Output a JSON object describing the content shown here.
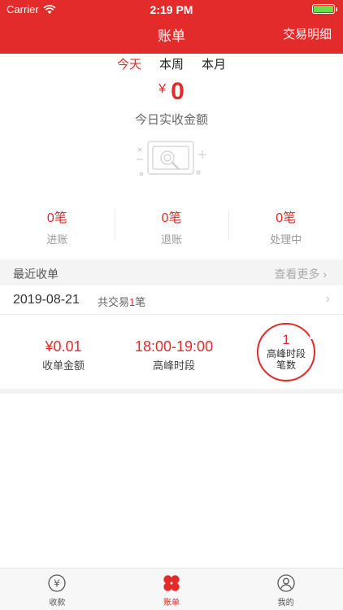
{
  "status_bar": {
    "carrier": "Carrier",
    "time": "2:19 PM"
  },
  "nav": {
    "title": "账单",
    "right_link": "交易明细"
  },
  "period_tabs": [
    {
      "label": "今天",
      "active": true
    },
    {
      "label": "本周",
      "active": false
    },
    {
      "label": "本月",
      "active": false
    }
  ],
  "today": {
    "currency": "¥",
    "amount": "0",
    "label": "今日实收金额"
  },
  "stats": [
    {
      "value": "0笔",
      "label": "进账"
    },
    {
      "value": "0笔",
      "label": "退账"
    },
    {
      "value": "0笔",
      "label": "处理中"
    }
  ],
  "recent": {
    "title": "最近收单",
    "more": "查看更多",
    "more_icon": "chevron-right-icon"
  },
  "day": {
    "date": "2019-08-21",
    "count_prefix": "共交易",
    "count": "1",
    "count_suffix": "笔"
  },
  "summary": {
    "amount_value": "¥0.01",
    "amount_label": "收单金额",
    "peak_time_value": "18:00-19:00",
    "peak_time_label": "高峰时段",
    "peak_count_value": "1",
    "peak_count_label_line1": "高峰时段",
    "peak_count_label_line2": "笔数"
  },
  "tabbar": [
    {
      "label": "收款",
      "icon": "yen-circle-icon",
      "active": false
    },
    {
      "label": "账单",
      "icon": "clover-icon",
      "active": true
    },
    {
      "label": "我的",
      "icon": "user-circle-icon",
      "active": false
    }
  ],
  "colors": {
    "accent": "#e32b2b",
    "battery": "#6bdc4a",
    "background": "#ffffff"
  }
}
